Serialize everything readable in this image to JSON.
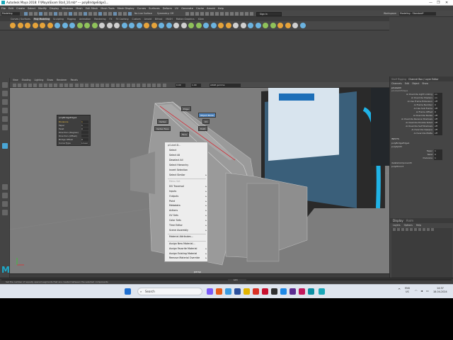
{
  "window": {
    "title": "Autodesk Maya 2018: F:\\Maya\\Exam Stall_10.mb* --- polyBridgeEdge1...",
    "controls": [
      "—",
      "❐",
      "✕"
    ]
  },
  "menu": [
    "File",
    "Edit",
    "Create",
    "Select",
    "Modify",
    "Display",
    "Windows",
    "Mesh",
    "Edit Mesh",
    "Mesh Tools",
    "Mesh Display",
    "Curves",
    "Surfaces",
    "Deform",
    "UV",
    "Generate",
    "Cache",
    "Arnold",
    "Help"
  ],
  "status_line": {
    "mode": "Modeling",
    "no_live": "No Live Surface",
    "symmetry": "Symmetry: Off",
    "sign_in": "Sign In",
    "workspace_label": "Workspace:",
    "workspace": "Modeling - Standard*"
  },
  "shelf_tabs": [
    "Curves / Surfaces",
    "Poly Modeling",
    "Sculpting",
    "Rigging",
    "Animation",
    "Rendering",
    "FX",
    "FX Caching",
    "Custom",
    "Arnold",
    "Bifrost",
    "MASH",
    "Motion Graphics",
    "XGen"
  ],
  "shelf_active": "Poly Modeling",
  "viewport_menu": [
    "View",
    "Shading",
    "Lighting",
    "Show",
    "Renderer",
    "Panels"
  ],
  "viewport_toolbar": {
    "value1": "0.00",
    "value2": "1.00",
    "colorspace": "sRGB gamma"
  },
  "hud": {
    "title": "polyBridgeEdge1",
    "rows": [
      {
        "label": "Divisions",
        "value": "1"
      },
      {
        "label": "Taper",
        "value": "1"
      },
      {
        "label": "Twist",
        "value": "0"
      },
      {
        "label": "Direction (Degree)",
        "value": ""
      },
      {
        "label": "Direction (Offset)",
        "value": ""
      },
      {
        "label": "Bridge Offset",
        "value": "0"
      },
      {
        "label": "Curve Type",
        "value": "Linear"
      }
    ]
  },
  "marking_menu": {
    "north": "Edge",
    "northeast": "Object Mode",
    "east": "UV",
    "west": "Vertex",
    "southwest": "Vertex Face",
    "southeast": "Multi",
    "south": "Face"
  },
  "context_menu": {
    "header": "pCube1D...",
    "items": [
      {
        "label": "Select",
        "arrow": false,
        "dim": false
      },
      {
        "label": "Select All",
        "arrow": false,
        "dim": false
      },
      {
        "label": "Deselect All",
        "arrow": false,
        "dim": false
      },
      {
        "label": "Select Hierarchy",
        "arrow": false,
        "dim": false
      },
      {
        "label": "Invert Selection",
        "arrow": false,
        "dim": false
      },
      {
        "label": "Select Similar",
        "arrow": true,
        "dim": false
      },
      {
        "label": "Menu Set",
        "arrow": false,
        "dim": true
      },
      {
        "label": "DG Traversal",
        "arrow": true,
        "dim": false
      },
      {
        "label": "Inputs",
        "arrow": true,
        "dim": false
      },
      {
        "label": "Outputs",
        "arrow": true,
        "dim": false
      },
      {
        "label": "Paint",
        "arrow": true,
        "dim": false
      },
      {
        "label": "Metadata",
        "arrow": true,
        "dim": false
      },
      {
        "label": "Actions",
        "arrow": true,
        "dim": false
      },
      {
        "label": "UV Sets",
        "arrow": true,
        "dim": false
      },
      {
        "label": "Color Sets",
        "arrow": true,
        "dim": false
      },
      {
        "label": "Time Editor",
        "arrow": true,
        "dim": false
      },
      {
        "label": "Scene Assembly",
        "arrow": true,
        "dim": false
      },
      {
        "label": "Material Attributes...",
        "arrow": false,
        "dim": false
      },
      {
        "label": "Assign New Material...",
        "arrow": false,
        "dim": false
      },
      {
        "label": "Assign Favorite Material",
        "arrow": true,
        "dim": false
      },
      {
        "label": "Assign Existing Material",
        "arrow": true,
        "dim": false
      },
      {
        "label": "Remove Material Override",
        "arrow": true,
        "dim": false
      }
    ]
  },
  "right_panel": {
    "tabs": [
      "Channel Box / Layer Editor"
    ],
    "side_tab": "Shelf Rigging",
    "subtabs": [
      "Channels",
      "Edit",
      "Object",
      "Show"
    ],
    "object": "pCube1D",
    "shape": "pCube1DShape",
    "attributes": [
      {
        "label": "Ai Override Light Linking",
        "value": "on"
      },
      {
        "label": "Ai Override Shaders",
        "value": "on"
      },
      {
        "label": "Ai Use Frame Extension",
        "value": "off"
      },
      {
        "label": "Ai Frame Number",
        "value": "0"
      },
      {
        "label": "Ai Use Sub Frame",
        "value": "off"
      },
      {
        "label": "Ai Frame Offset",
        "value": "0"
      },
      {
        "label": "Ai Override Nodes",
        "value": "off"
      },
      {
        "label": "Ai Override Receive Shadows",
        "value": "off"
      },
      {
        "label": "Ai Override Double Sided",
        "value": "off"
      },
      {
        "label": "Ai Override Self Shadows",
        "value": "off"
      },
      {
        "label": "Ai Override Opaque",
        "value": "off"
      },
      {
        "label": "Ai Override Matte",
        "value": "off"
      }
    ],
    "inputs_header": "INPUTS",
    "inputs": [
      "polyBridgeEdge1",
      "polySplit3"
    ],
    "input_attrs": [
      {
        "label": "Taper",
        "value": "1"
      },
      {
        "label": "Twist",
        "value": "0"
      },
      {
        "label": "Divisions",
        "value": "1"
      }
    ],
    "extra": [
      "deleteComponent3",
      "polyMirror3"
    ],
    "display_tab": "Display",
    "anim_tab": "Anim",
    "display_menu": [
      "Layers",
      "Options",
      "Help"
    ]
  },
  "cmd": {
    "lang": "MEL"
  },
  "help_line": "Set the number of equally spaced segments that are created between the selected components",
  "persp_label": "persp",
  "taskbar": {
    "search_placeholder": "Search",
    "lang": "ENG",
    "region": "US",
    "time": "14:37",
    "date": "18-04-2024"
  },
  "colors": {
    "maya_accent": "#1aa7b8",
    "selection_blue": "#5287c0",
    "viewport_bg": "#7d7d7d"
  }
}
